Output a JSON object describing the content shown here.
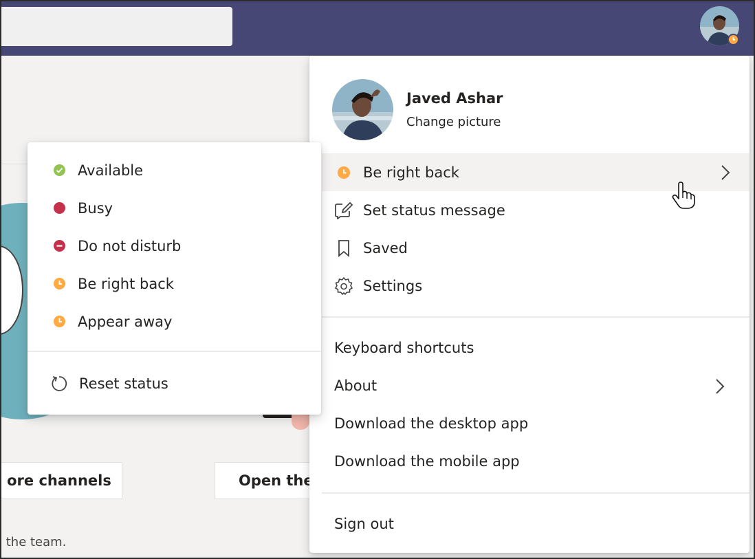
{
  "colors": {
    "header": "#464775",
    "available": "#92c353",
    "busy": "#c4314b",
    "away": "#ffaa44",
    "panel": "#ffffff"
  },
  "background": {
    "btn_channels": "ore channels",
    "btn_open": "Open the",
    "caption": "o the team."
  },
  "profile": {
    "name": "Javed Ashar",
    "change_picture": "Change picture",
    "current_status": "Be right back",
    "set_status_message": "Set status message",
    "saved": "Saved",
    "settings": "Settings",
    "keyboard_shortcuts": "Keyboard shortcuts",
    "about": "About",
    "download_desktop": "Download the desktop app",
    "download_mobile": "Download the mobile app",
    "sign_out": "Sign out"
  },
  "status_menu": {
    "items": [
      {
        "label": "Available",
        "icon": "available-icon"
      },
      {
        "label": "Busy",
        "icon": "busy-icon"
      },
      {
        "label": "Do not disturb",
        "icon": "do-not-disturb-icon"
      },
      {
        "label": "Be right back",
        "icon": "clock-icon"
      },
      {
        "label": "Appear away",
        "icon": "clock-icon"
      }
    ],
    "reset": "Reset status"
  }
}
